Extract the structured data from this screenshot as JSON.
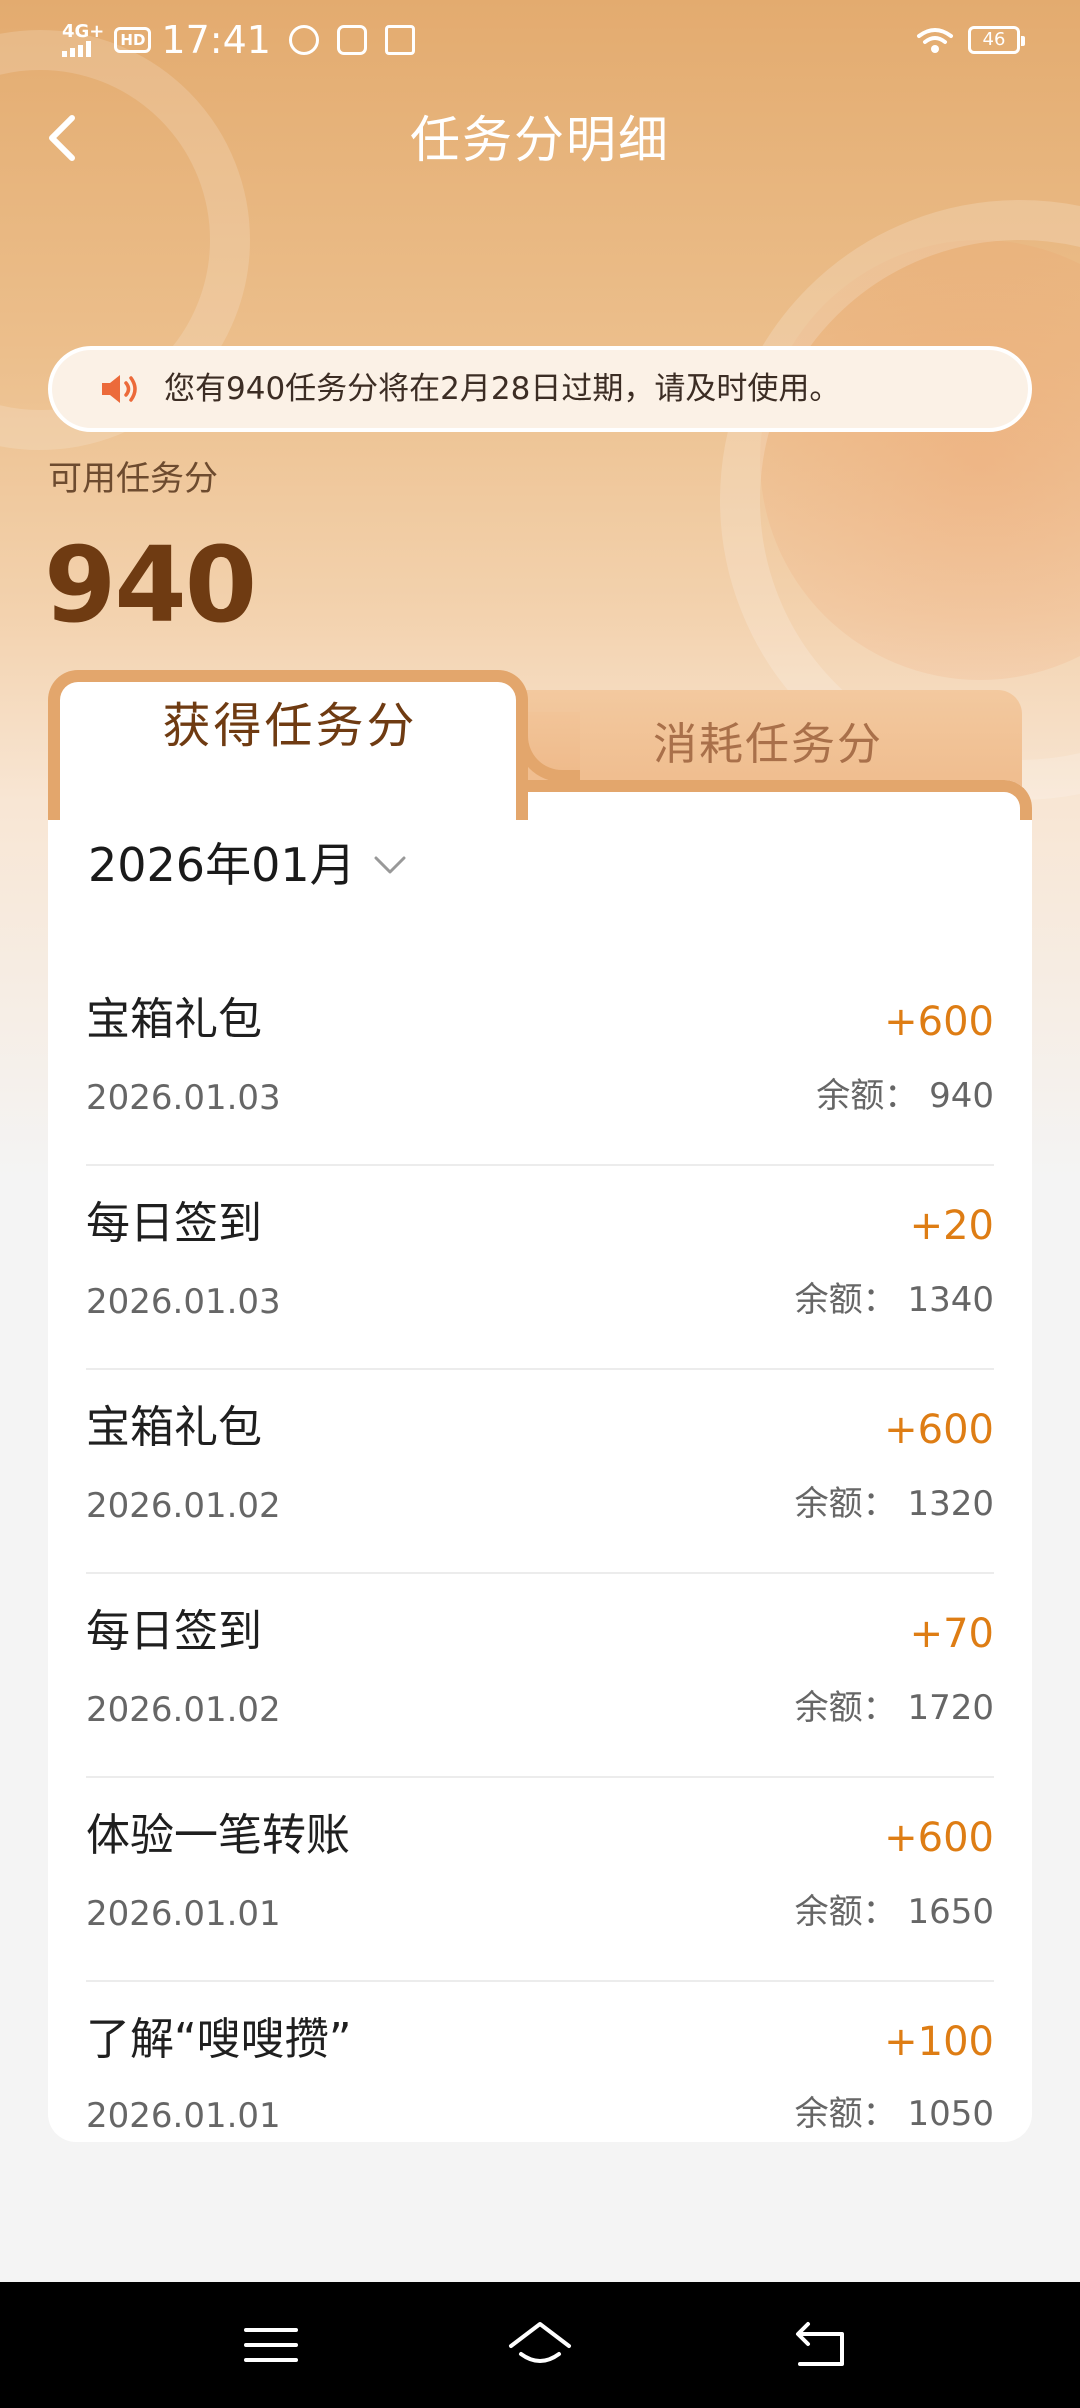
{
  "status_bar": {
    "network": "4G+",
    "hd": "HD",
    "time": "17:41",
    "battery": "46"
  },
  "header": {
    "title": "任务分明细"
  },
  "notice": {
    "text": "您有940任务分将在2月28日过期，请及时使用。"
  },
  "balance": {
    "label": "可用任务分",
    "value": "940"
  },
  "tabs": [
    {
      "label": "获得任务分",
      "active": true
    },
    {
      "label": "消耗任务分",
      "active": false
    }
  ],
  "month_selector": {
    "value": "2026年01月"
  },
  "records": [
    {
      "name": "宝箱礼包",
      "date": "2026.01.03",
      "amount": "+600",
      "balance": "余额：  940"
    },
    {
      "name": "每日签到",
      "date": "2026.01.03",
      "amount": "+20",
      "balance": "余额：  1340"
    },
    {
      "name": "宝箱礼包",
      "date": "2026.01.02",
      "amount": "+600",
      "balance": "余额：  1320"
    },
    {
      "name": "每日签到",
      "date": "2026.01.02",
      "amount": "+70",
      "balance": "余额：  1720"
    },
    {
      "name": "体验一笔转账",
      "date": "2026.01.01",
      "amount": "+600",
      "balance": "余额：  1650"
    },
    {
      "name": "了解“嗖嗖攒”",
      "date": "2026.01.01",
      "amount": "+100",
      "balance": "余额：  1050"
    }
  ],
  "colors": {
    "accent": "#de7d14",
    "tab_border": "#e3a66c",
    "balance_text": "#6f3b12"
  },
  "icons": {
    "back": "back-arrow-icon",
    "speaker": "speaker-icon",
    "chevron": "chevron-down-icon",
    "nav_menu": "menu-icon",
    "nav_home": "home-icon",
    "nav_back": "return-icon"
  }
}
